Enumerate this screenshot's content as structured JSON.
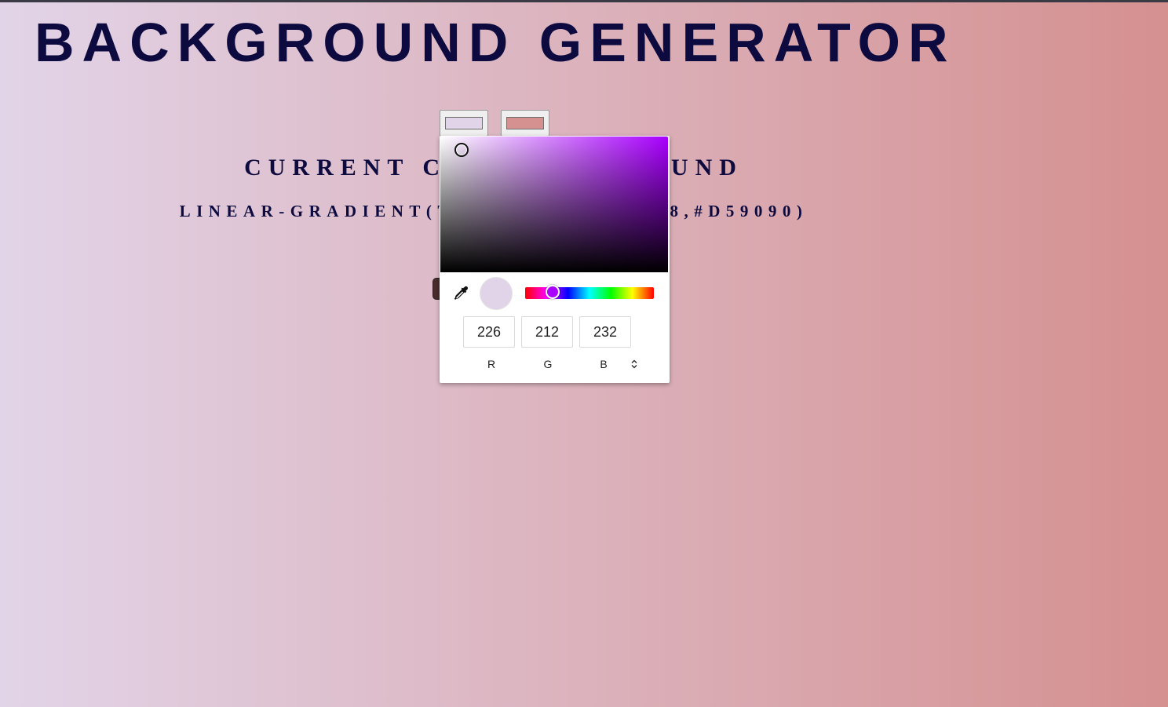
{
  "app": {
    "title": "BACKGROUND GENERATOR",
    "subtitle": "CURRENT CSS BACKGROUND",
    "css_output": "LINEAR-GRADIENT(TO RIGHT,#E2D4E8,#D59090)"
  },
  "colors": {
    "color1": "#e2d4e8",
    "color2": "#d59090",
    "text": "#0c0a3e"
  },
  "picker": {
    "hue_color": "#a900ff",
    "hue_level": 0.785,
    "preview_color": "#e2d4e8",
    "channels": [
      {
        "label": "R",
        "value": "226"
      },
      {
        "label": "G",
        "value": "212"
      },
      {
        "label": "B",
        "value": "232"
      }
    ],
    "eyedropper_icon": "eyedropper-icon",
    "mode_toggle_icon": "updown-chevron-icon"
  }
}
